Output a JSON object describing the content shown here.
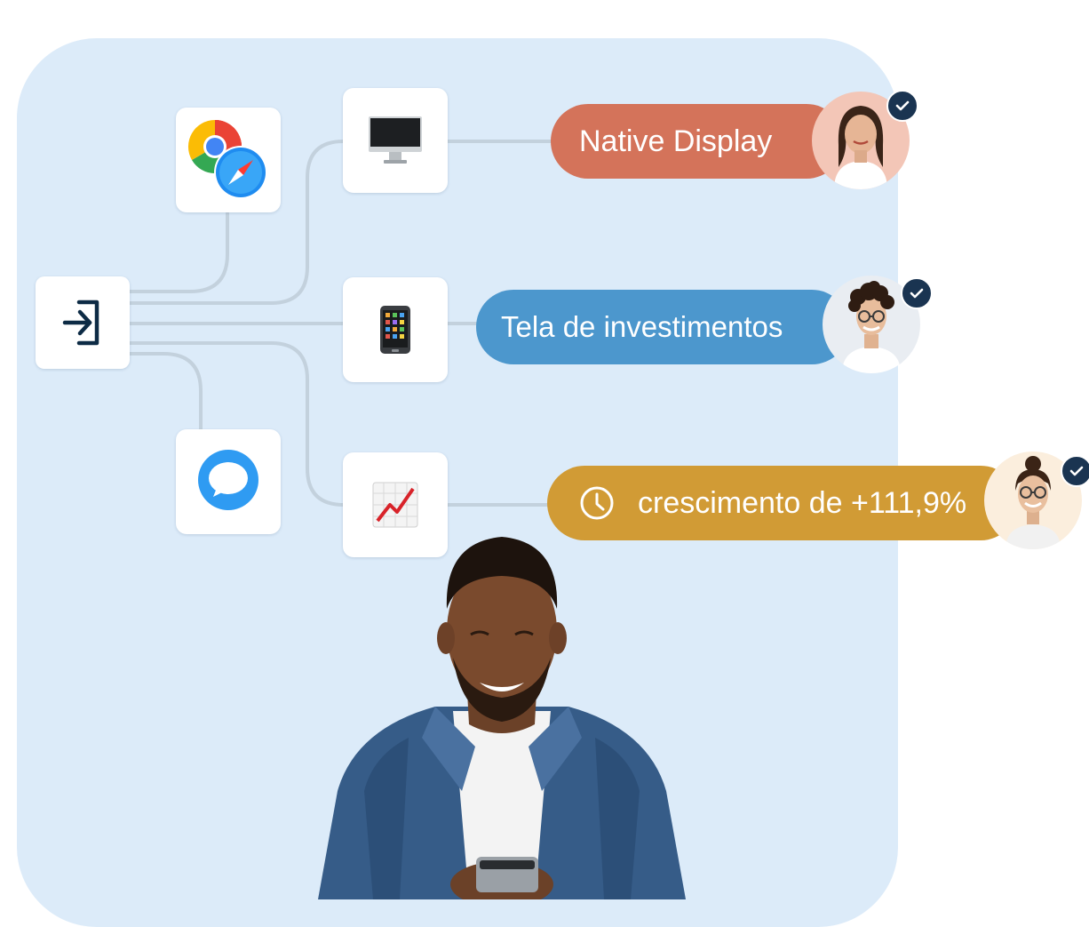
{
  "flow": {
    "nodes": [
      {
        "id": "entry",
        "icon": "login-arrow-icon"
      },
      {
        "id": "browsers",
        "icon": "chrome-safari-icon"
      },
      {
        "id": "chat",
        "icon": "chat-bubble-icon"
      },
      {
        "id": "desktop",
        "icon": "desktop-monitor-icon"
      },
      {
        "id": "mobile",
        "icon": "mobile-phone-icon"
      },
      {
        "id": "growth",
        "icon": "chart-increasing-icon"
      }
    ],
    "results": {
      "native": {
        "label": "Native Display",
        "color": "#d4735a"
      },
      "tela": {
        "label": "Tela de investimentos",
        "color": "#4c97cd"
      },
      "growth": {
        "label": "crescimento de +111,9%",
        "color": "#d19b35",
        "icon": "clock-icon"
      }
    }
  },
  "colors": {
    "panel": "#dcebf9",
    "connector": "#c3d1dd",
    "check_badge": "#1a3451"
  }
}
